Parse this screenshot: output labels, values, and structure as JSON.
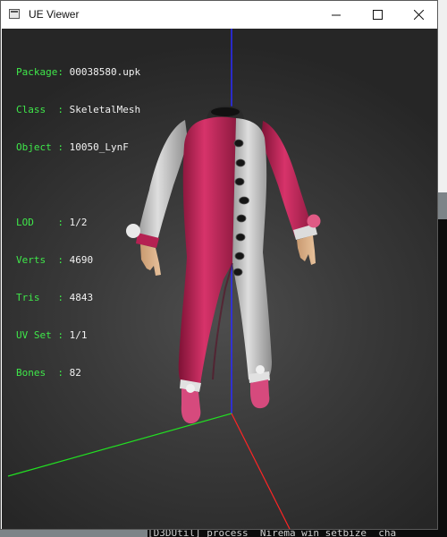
{
  "window": {
    "title": "UE Viewer",
    "controls": {
      "minimize": "minimize",
      "maximize": "maximize",
      "close": "close"
    }
  },
  "info": {
    "package": {
      "label": "Package: ",
      "value": "00038580.upk"
    },
    "class": {
      "label": "Class  : ",
      "value": "SkeletalMesh"
    },
    "object": {
      "label": "Object : ",
      "value": "10050_LynF"
    },
    "lod": {
      "label": "LOD    : ",
      "value": "1/2"
    },
    "verts": {
      "label": "Verts  : ",
      "value": "4690"
    },
    "tris": {
      "label": "Tris   : ",
      "value": "4843"
    },
    "uvset": {
      "label": "UV Set : ",
      "value": "1/1"
    },
    "bones": {
      "label": "Bones  : ",
      "value": "82"
    }
  },
  "background_console": {
    "bottom_line": "[D3DUtil] process  Nirema win setbize  cha"
  },
  "colors": {
    "overlay_label": "#3fe84a",
    "overlay_value": "#f2f2f2",
    "axis_x": "#ff2020",
    "axis_y": "#20e020",
    "axis_z": "#2020ff",
    "garment_pink": "#c42a5a",
    "garment_white": "#e3e3e3"
  }
}
